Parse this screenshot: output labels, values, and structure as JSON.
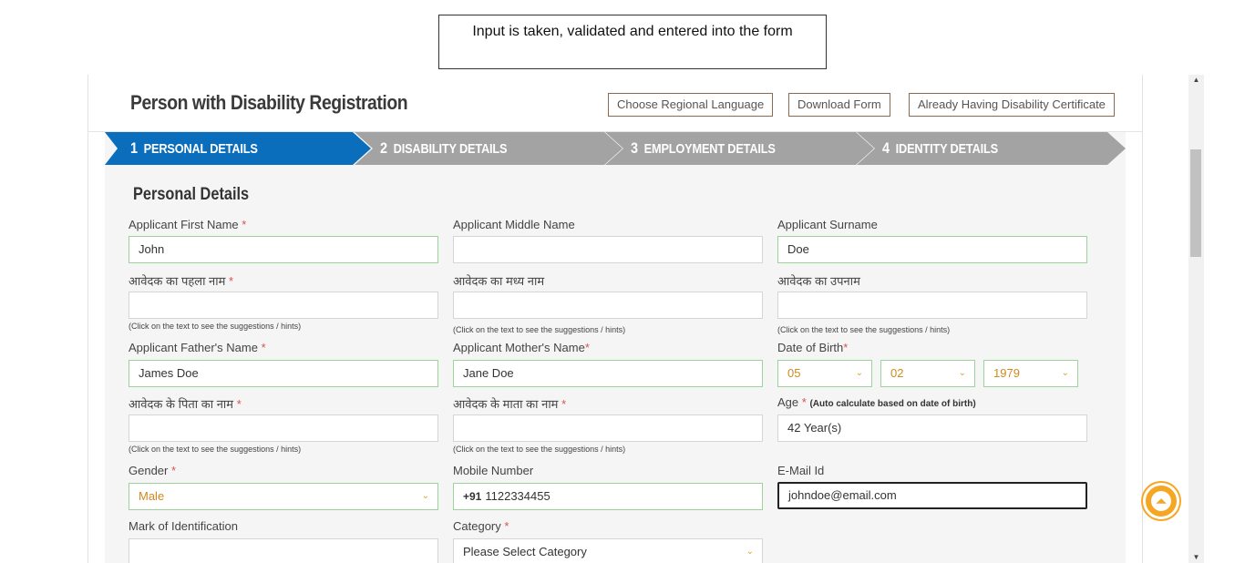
{
  "caption": "Input is taken, validated and entered into the form",
  "header": {
    "title": "Person with Disability Registration",
    "buttons": {
      "regional_language": "Choose Regional Language",
      "download_form": "Download Form",
      "already_certificate": "Already Having Disability Certificate"
    }
  },
  "steps": [
    {
      "num": "1",
      "label": "PERSONAL DETAILS",
      "active": true
    },
    {
      "num": "2",
      "label": "DISABILITY DETAILS",
      "active": false
    },
    {
      "num": "3",
      "label": "EMPLOYMENT DETAILS",
      "active": false
    },
    {
      "num": "4",
      "label": "IDENTITY DETAILS",
      "active": false
    }
  ],
  "colors": {
    "step_active": "#0a6ebd",
    "step_inactive": "#a3a3a3",
    "required": "#d9534f",
    "valid_border": "#9bd39b",
    "accent": "#f5a623"
  },
  "section_title": "Personal Details",
  "hint_text": "(Click on the text to see the suggestions / hints)",
  "form": {
    "first_name": {
      "label": "Applicant First Name",
      "req": "*",
      "value": "John"
    },
    "middle_name": {
      "label": "Applicant Middle Name",
      "value": ""
    },
    "surname": {
      "label": "Applicant Surname",
      "value": "Doe"
    },
    "first_name_hi": {
      "label": "आवेदक का पहला नाम",
      "req": "*",
      "value": ""
    },
    "middle_name_hi": {
      "label": "आवेदक का मध्य नाम",
      "value": ""
    },
    "surname_hi": {
      "label": "आवेदक का उपनाम",
      "value": ""
    },
    "father_name": {
      "label": "Applicant Father's Name",
      "req": "*",
      "value": "James Doe"
    },
    "mother_name": {
      "label": "Applicant Mother's Name",
      "req": "*",
      "value": "Jane Doe"
    },
    "dob": {
      "label": "Date of Birth",
      "req": "*",
      "day": "05",
      "month": "02",
      "year": "1979"
    },
    "father_name_hi": {
      "label": "आवेदक के पिता का नाम",
      "req": "*",
      "value": ""
    },
    "mother_name_hi": {
      "label": "आवेदक के माता का नाम",
      "req": "*",
      "value": ""
    },
    "age": {
      "label": "Age",
      "req": "*",
      "note": "(Auto calculate based on date of birth)",
      "value": "42 Year(s)"
    },
    "gender": {
      "label": "Gender",
      "req": "*",
      "value": "Male"
    },
    "mobile": {
      "label": "Mobile Number",
      "prefix": "+91",
      "value": "1122334455"
    },
    "email": {
      "label": "E-Mail Id",
      "value": "johndoe@email.com"
    },
    "mark": {
      "label": "Mark of Identification",
      "value": ""
    },
    "category": {
      "label": "Category",
      "req": "*",
      "value": "Please Select Category"
    }
  },
  "icons": {
    "chevron": "chevron-down-icon",
    "scroll_top": "arrow-up-icon"
  }
}
